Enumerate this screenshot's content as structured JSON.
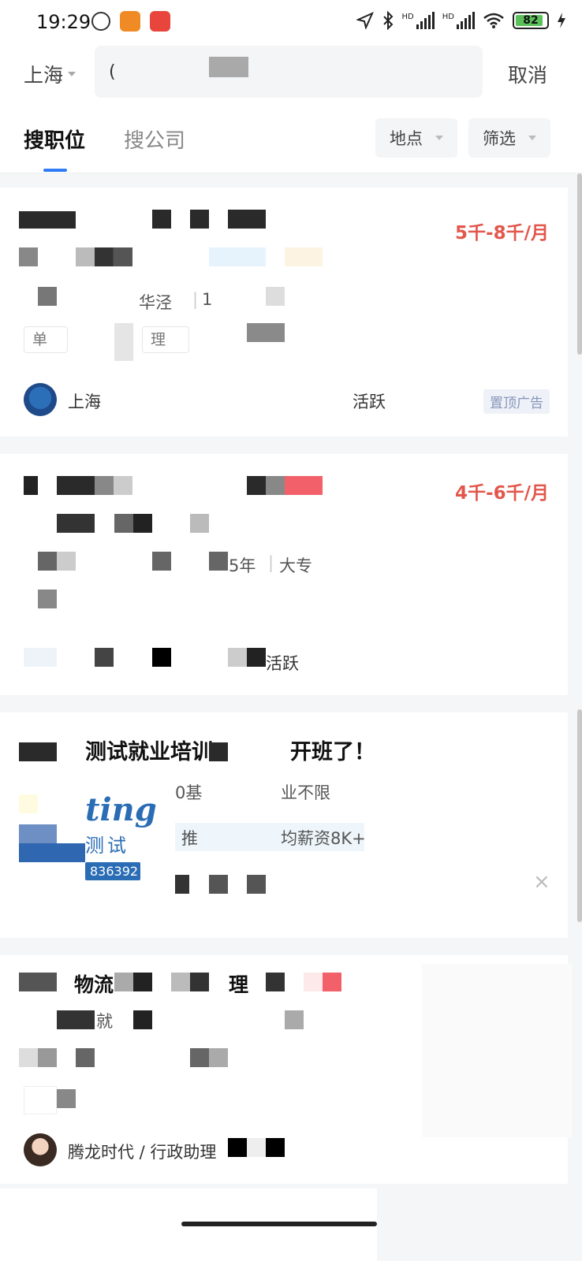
{
  "status_bar": {
    "time": "19:29",
    "network_label": "HD",
    "battery": "82",
    "icons": [
      "alarm-icon",
      "app-notification-icon",
      "app-notification-icon",
      "location-arrow-icon",
      "bluetooth-icon",
      "signal-icon",
      "signal-icon",
      "wifi-icon",
      "battery-icon",
      "charging-icon"
    ]
  },
  "search": {
    "city": "上海",
    "query": "(",
    "cancel_label": "取消"
  },
  "tabs": {
    "jobs_label": "搜职位",
    "companies_label": "搜公司",
    "location_label": "地点",
    "filter_label": "筛选"
  },
  "job_cards": [
    {
      "salary": "5千-8千/月",
      "location_fragment": "华泾",
      "experience_fragment": "1",
      "tag_fragment_1": "单",
      "tag_fragment_2": "理",
      "company_fragment": "上海",
      "active_fragment": "活跃",
      "ad_badge": "置顶广告"
    },
    {
      "salary": "4千-6千/月",
      "experience_fragment": "5年",
      "education": "大专",
      "active_fragment": "活跃"
    },
    {
      "title_fragment": "物流",
      "title_fragment_2": "理",
      "body_fragment": "就",
      "company_line": "腾龙时代 / 行政助理"
    }
  ],
  "ad_card": {
    "title_part1": "测试就业培训",
    "title_part2": "开班了！",
    "sub_part1": "0基",
    "sub_part2": "业不限",
    "strip_part1": "推",
    "strip_part2": "均薪资8K+",
    "logo_text": "ting",
    "logo_cn": "测试",
    "logo_number": "836392",
    "close_symbol": "×"
  },
  "colors": {
    "salary": "#e2574c",
    "accent": "#2f7cf6",
    "ad_logo": "#2a6db5"
  }
}
